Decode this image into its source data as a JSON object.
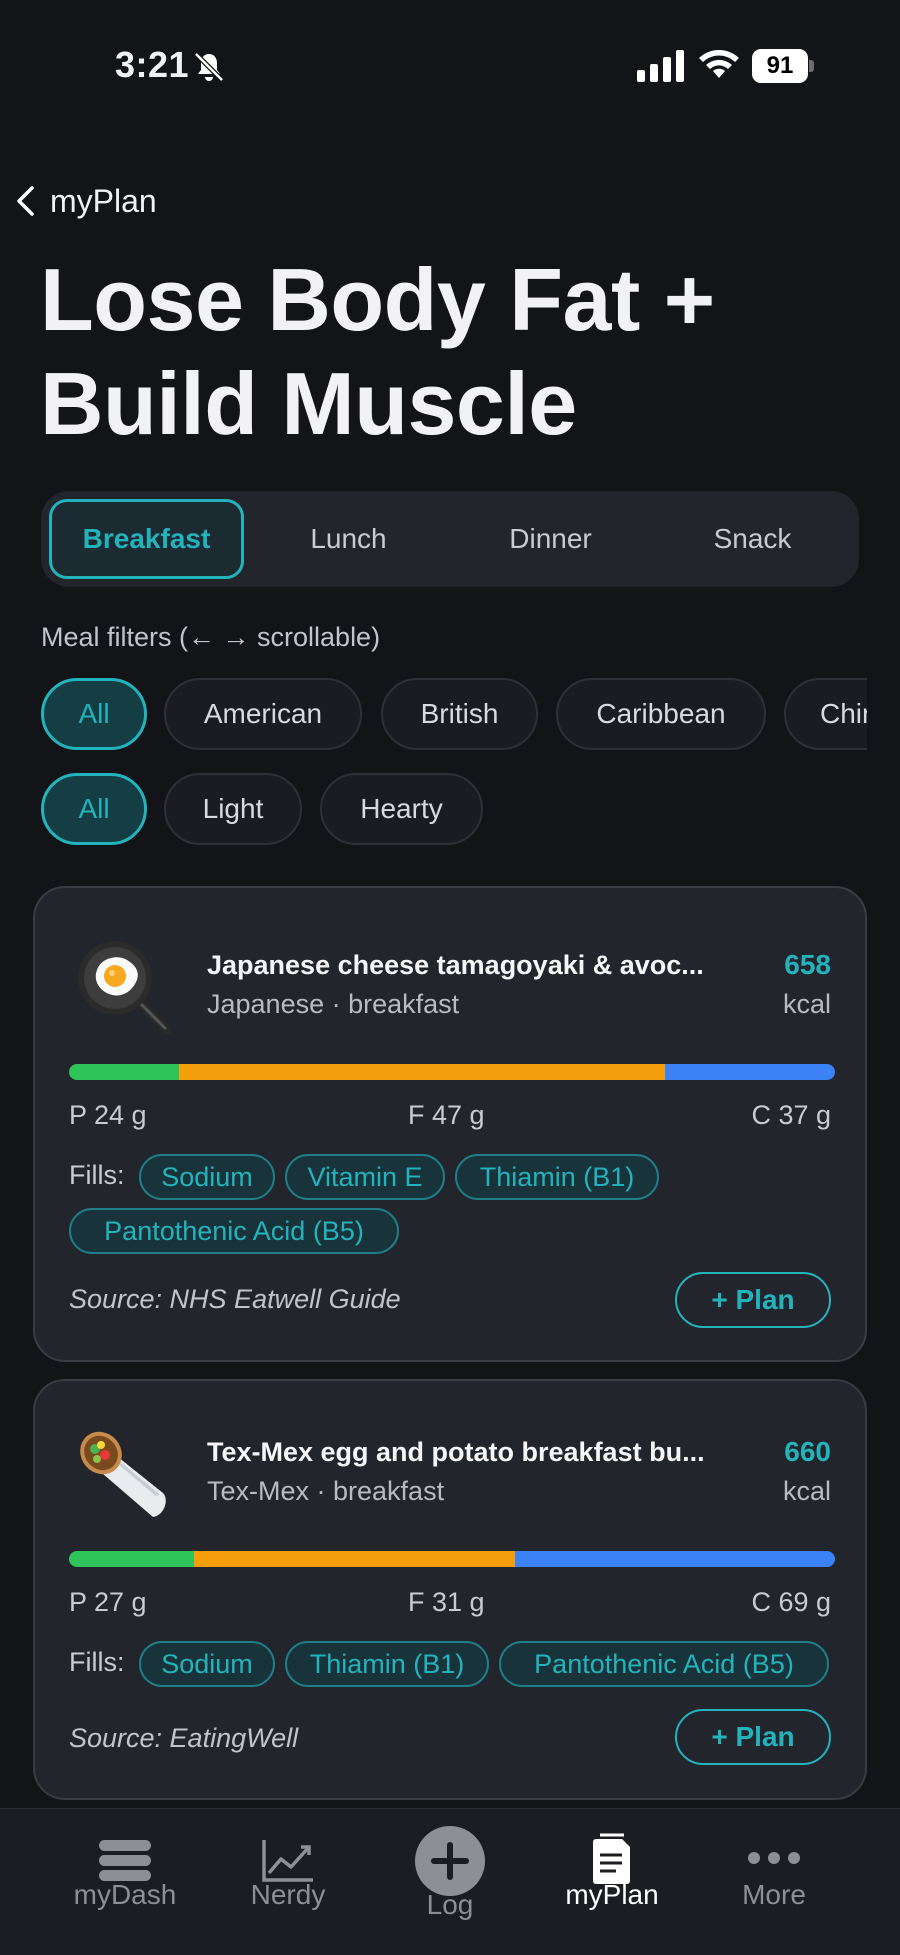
{
  "status_bar": {
    "time": "3:21",
    "battery": "91"
  },
  "nav": {
    "back_label": "myPlan"
  },
  "title": "Lose Body Fat + Build Muscle",
  "meal_tabs": [
    {
      "label": "Breakfast",
      "active": true
    },
    {
      "label": "Lunch",
      "active": false
    },
    {
      "label": "Dinner",
      "active": false
    },
    {
      "label": "Snack",
      "active": false
    }
  ],
  "filters": {
    "label": "Meal filters (← → scrollable)",
    "cuisine": [
      "All",
      "American",
      "British",
      "Caribbean",
      "Chinese"
    ],
    "size": [
      "All",
      "Light",
      "Hearty"
    ],
    "selected_cuisine": "All",
    "selected_size": "All"
  },
  "meals": [
    {
      "emoji": "frying-pan-egg",
      "name": "Japanese cheese tamagoyaki & avoc...",
      "subtitle": "Japanese · breakfast",
      "kcal": "658",
      "kcal_unit": "kcal",
      "macro_bar_fraction": {
        "protein": 0.143,
        "fat": 0.635,
        "carbs": 0.222
      },
      "protein": "P 24 g",
      "fat": "F 47 g",
      "carbs": "C 37 g",
      "fills_label": "Fills:",
      "fills": [
        "Sodium",
        "Vitamin E",
        "Thiamin (B1)",
        "Pantothenic Acid (B5)"
      ],
      "source": "Source: NHS Eatwell Guide",
      "plan_label": "+ Plan"
    },
    {
      "emoji": "burrito",
      "name": "Tex-Mex egg and potato breakfast bu...",
      "subtitle": "Tex-Mex · breakfast",
      "kcal": "660",
      "kcal_unit": "kcal",
      "macro_bar_fraction": {
        "protein": 0.163,
        "fat": 0.419,
        "carbs": 0.418
      },
      "protein": "P 27 g",
      "fat": "F 31 g",
      "carbs": "C 69 g",
      "fills_label": "Fills:",
      "fills": [
        "Sodium",
        "Thiamin (B1)",
        "Pantothenic Acid (B5)"
      ],
      "source": "Source: EatingWell",
      "plan_label": "+ Plan"
    }
  ],
  "tab_bar": [
    {
      "label": "myDash",
      "icon": "stack-icon",
      "active": false
    },
    {
      "label": "Nerdy",
      "icon": "chart-icon",
      "active": false
    },
    {
      "label": "Log",
      "icon": "plus-circle-icon",
      "active": false
    },
    {
      "label": "myPlan",
      "icon": "document-icon",
      "active": true
    },
    {
      "label": "More",
      "icon": "ellipsis-icon",
      "active": false
    }
  ],
  "colors": {
    "accent": "#22b3bd",
    "protein": "#2ec45a",
    "fat": "#f59e0b",
    "carbs": "#3b82f6",
    "background": "#131418",
    "card": "#23252c"
  }
}
